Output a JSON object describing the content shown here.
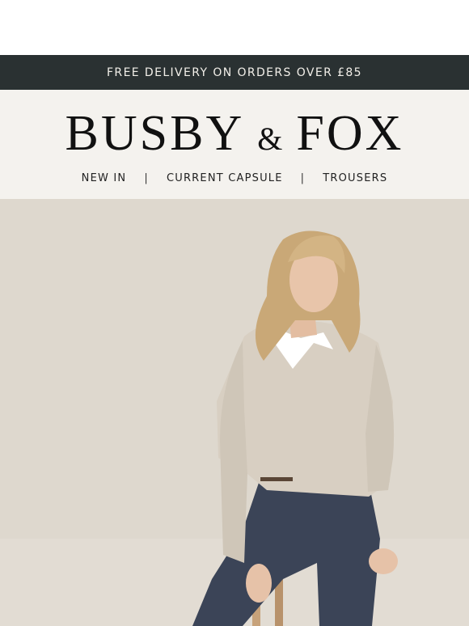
{
  "promo": {
    "text": "FREE DELIVERY ON ORDERS OVER £85"
  },
  "brand": {
    "word1": "BUSBY",
    "amp": "&",
    "word2": "FOX"
  },
  "nav": {
    "items": [
      "NEW IN",
      "CURRENT CAPSULE",
      "TROUSERS"
    ],
    "separator": "|"
  },
  "colors": {
    "promo_bg": "#2a3132",
    "header_bg": "#f4f2ee",
    "hero_bg": "#ddd6cc"
  },
  "hero": {
    "image": "woman-seated-on-stool-in-knit-sweater-and-navy-trousers"
  }
}
